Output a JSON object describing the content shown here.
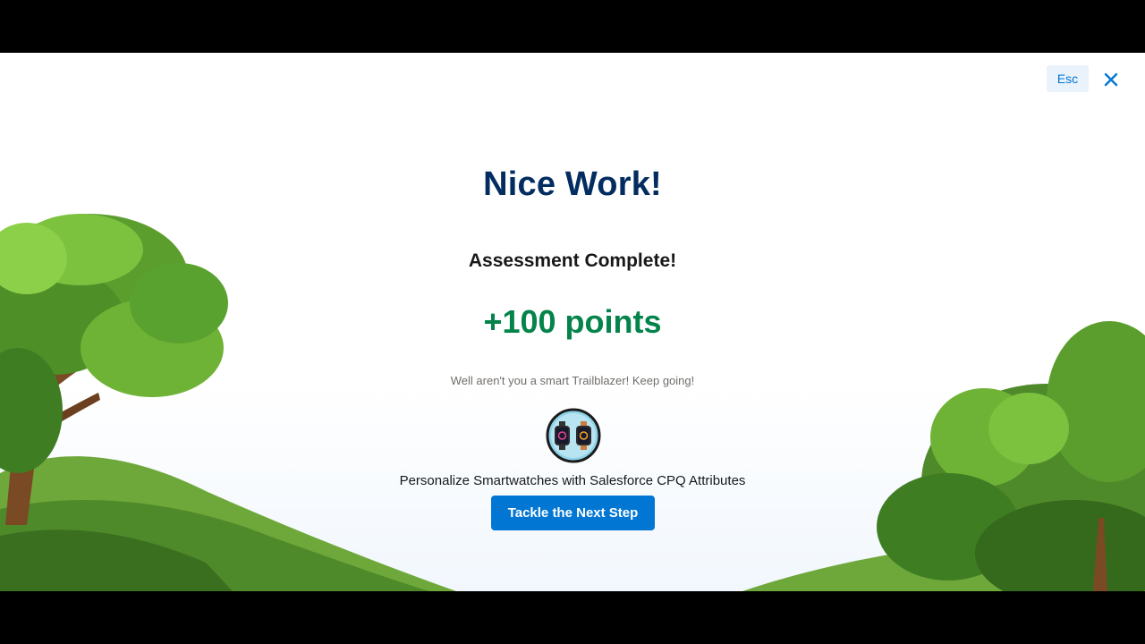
{
  "header": {
    "esc_label": "Esc",
    "close_icon": "close-icon"
  },
  "completion": {
    "title": "Nice Work!",
    "subtitle": "Assessment Complete!",
    "points": "+100 points",
    "message": "Well aren't you a smart Trailblazer! Keep going!",
    "badge_icon": "smartwatch-badge-icon",
    "module_name": "Personalize Smartwatches with Salesforce CPQ Attributes",
    "next_button_label": "Tackle the Next Step"
  },
  "colors": {
    "title": "#032d60",
    "points": "#04844b",
    "button": "#0176d3",
    "esc_background": "#eaf2fb"
  }
}
